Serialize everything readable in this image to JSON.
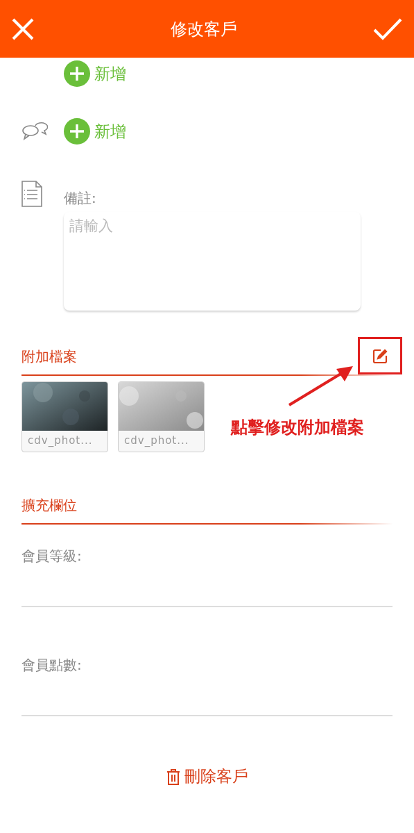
{
  "header": {
    "title": "修改客戶"
  },
  "contact_rows": [
    {
      "kind": "plain",
      "label": "新增"
    },
    {
      "kind": "chat",
      "label": "新增"
    }
  ],
  "notes": {
    "label": "備註:",
    "placeholder": "請輸入"
  },
  "attachments": {
    "title": "附加檔案",
    "files": [
      {
        "name": "cdv_phot..."
      },
      {
        "name": "cdv_phot..."
      }
    ]
  },
  "annotation": {
    "text": "點擊修改附加檔案"
  },
  "extra_fields": {
    "title": "擴充欄位",
    "fields": [
      {
        "label": "會員等級:"
      },
      {
        "label": "會員點數:"
      }
    ]
  },
  "delete_button": {
    "label": "刪除客戶"
  }
}
